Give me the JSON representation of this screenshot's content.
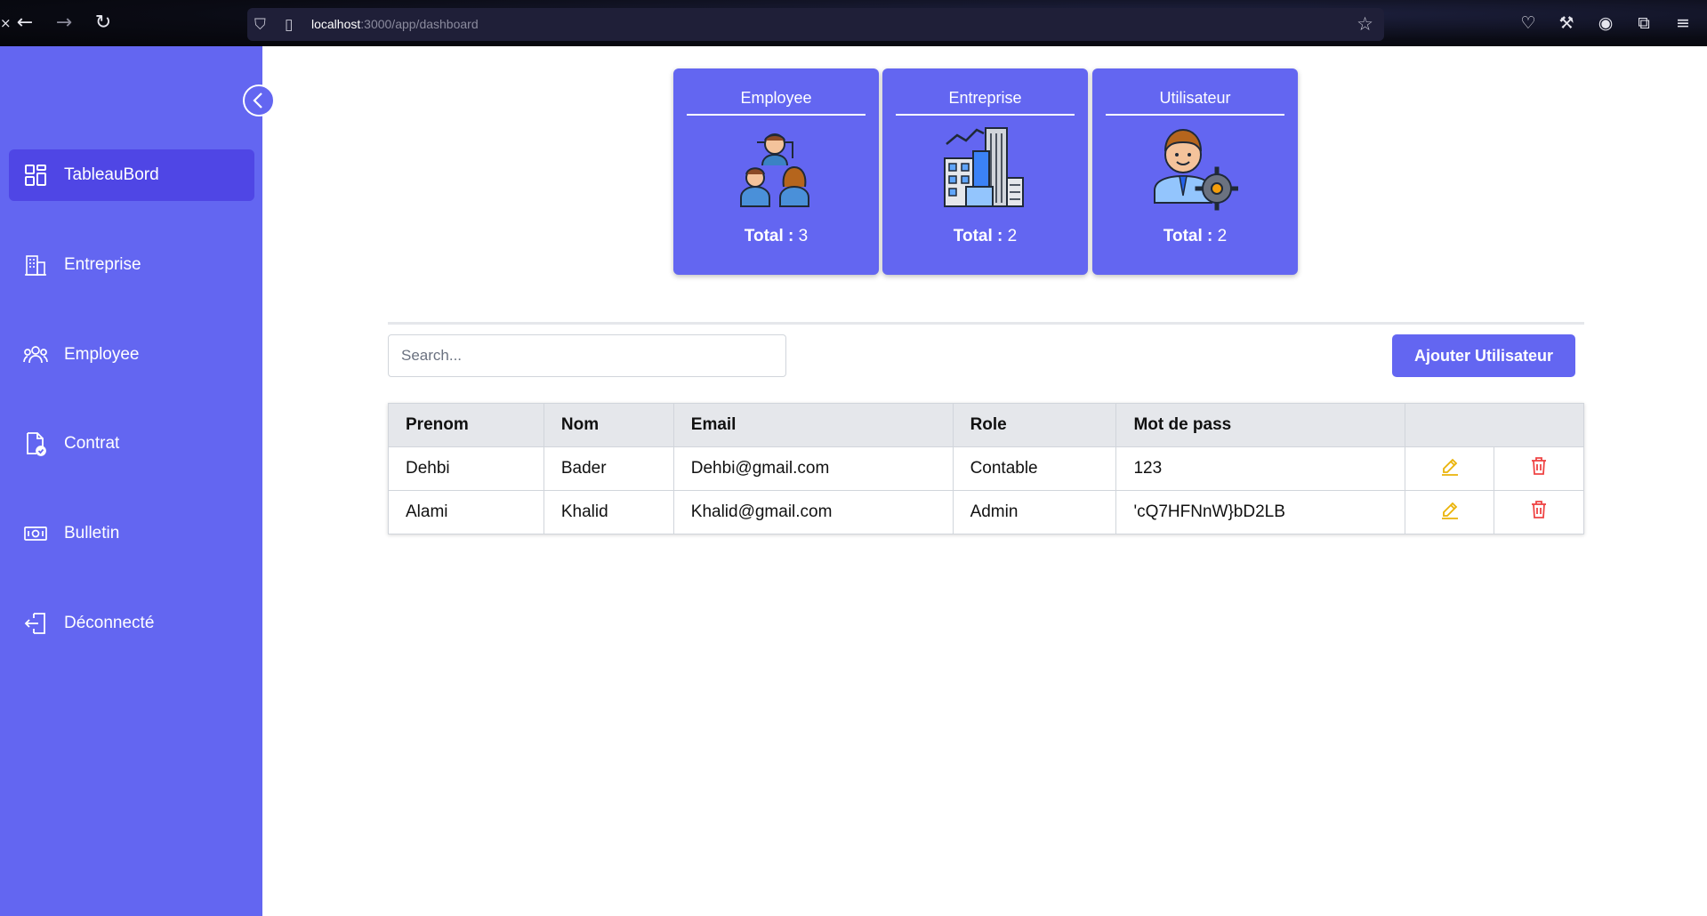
{
  "browser": {
    "url_host": "localhost",
    "url_path": ":3000/app/dashboard"
  },
  "sidebar": {
    "items": [
      {
        "label": "TableauBord",
        "icon": "dashboard-grid-icon",
        "active": true
      },
      {
        "label": "Entreprise",
        "icon": "building-icon"
      },
      {
        "label": "Employee",
        "icon": "users-icon"
      },
      {
        "label": "Contrat",
        "icon": "document-check-icon"
      },
      {
        "label": "Bulletin",
        "icon": "banknote-icon"
      },
      {
        "label": "Déconnecté",
        "icon": "logout-icon"
      }
    ]
  },
  "cards": [
    {
      "title": "Employee",
      "total_label": "Total :",
      "total_value": "3",
      "icon": "team-people-icon"
    },
    {
      "title": "Entreprise",
      "total_label": "Total :",
      "total_value": "2",
      "icon": "city-buildings-icon"
    },
    {
      "title": "Utilisateur",
      "total_label": "Total :",
      "total_value": "2",
      "icon": "user-settings-icon"
    }
  ],
  "toolbar": {
    "search_placeholder": "Search...",
    "add_label": "Ajouter Utilisateur"
  },
  "table": {
    "headers": [
      "Prenom",
      "Nom",
      "Email",
      "Role",
      "Mot de pass",
      ""
    ],
    "rows": [
      [
        "Dehbi",
        "Bader",
        "Dehbi@gmail.com",
        "Contable",
        "123"
      ],
      [
        "Alami",
        "Khalid",
        "Khalid@gmail.com",
        "Admin",
        "'cQ7HFNnW}bD2LB"
      ]
    ]
  },
  "colors": {
    "accent": "#6366f1",
    "active": "#4f46e5",
    "edit": "#eab308",
    "delete": "#ef4444"
  }
}
